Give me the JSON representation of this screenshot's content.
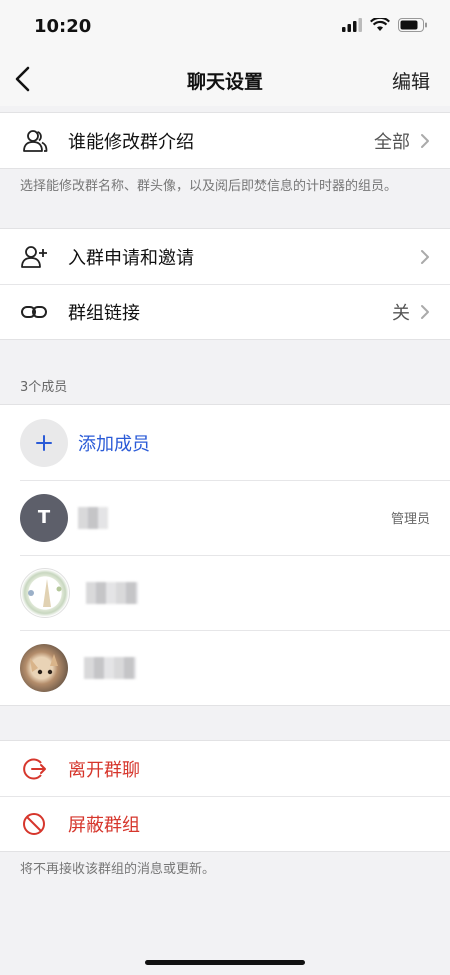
{
  "status_bar": {
    "time": "10:20"
  },
  "nav": {
    "title": "聊天设置",
    "edit_label": "编辑"
  },
  "group_info": {
    "label": "谁能修改群介绍",
    "value": "全部",
    "note": "选择能修改群名称、群头像，以及阅后即焚信息的计时器的组员。"
  },
  "options": {
    "join_label": "入群申请和邀请",
    "link_label": "群组链接",
    "link_value": "关"
  },
  "members": {
    "header": "3个成员",
    "add_label": "添加成员",
    "list": [
      {
        "avatar_letter": "T",
        "role": "管理员"
      },
      {
        "avatar_letter": "",
        "role": ""
      },
      {
        "avatar_letter": "",
        "role": ""
      }
    ]
  },
  "actions": {
    "leave_label": "离开群聊",
    "block_label": "屏蔽群组",
    "note": "将不再接收该群组的消息或更新。"
  },
  "colors": {
    "accent_blue": "#2b5bd7",
    "danger_red": "#d6362c",
    "admin_avatar": "#5d5f6a"
  }
}
